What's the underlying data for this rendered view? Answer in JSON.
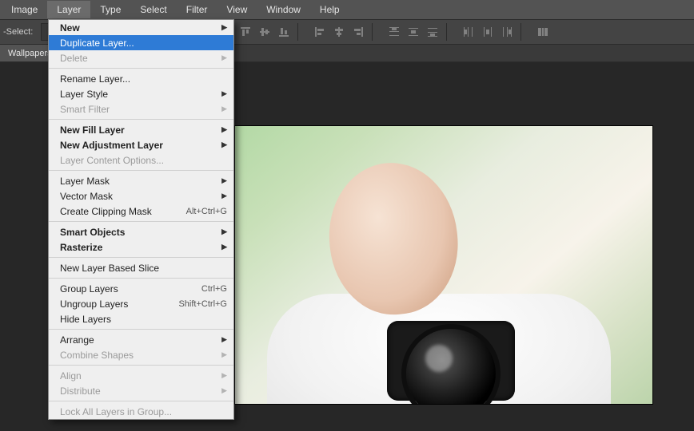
{
  "menubar": {
    "items": [
      "Image",
      "Layer",
      "Type",
      "Select",
      "Filter",
      "View",
      "Window",
      "Help"
    ],
    "active_index": 1
  },
  "toolbar": {
    "select_label": "-Select:"
  },
  "document": {
    "tab_label": "Wallpapers"
  },
  "dropdown": {
    "items": [
      {
        "label": "New",
        "arrow": true,
        "bold": true
      },
      {
        "label": "Duplicate Layer...",
        "highlighted": true
      },
      {
        "label": "Delete",
        "disabled": true,
        "arrow": true
      },
      {
        "sep": true
      },
      {
        "label": "Rename Layer..."
      },
      {
        "label": "Layer Style",
        "arrow": true
      },
      {
        "label": "Smart Filter",
        "disabled": true,
        "arrow": true
      },
      {
        "sep": true
      },
      {
        "label": "New Fill Layer",
        "arrow": true,
        "bold": true
      },
      {
        "label": "New Adjustment Layer",
        "arrow": true,
        "bold": true
      },
      {
        "label": "Layer Content Options...",
        "disabled": true
      },
      {
        "sep": true
      },
      {
        "label": "Layer Mask",
        "arrow": true
      },
      {
        "label": "Vector Mask",
        "arrow": true
      },
      {
        "label": "Create Clipping Mask",
        "shortcut": "Alt+Ctrl+G"
      },
      {
        "sep": true
      },
      {
        "label": "Smart Objects",
        "arrow": true,
        "bold": true
      },
      {
        "label": "Rasterize",
        "arrow": true,
        "bold": true
      },
      {
        "sep": true
      },
      {
        "label": "New Layer Based Slice"
      },
      {
        "sep": true
      },
      {
        "label": "Group Layers",
        "shortcut": "Ctrl+G"
      },
      {
        "label": "Ungroup Layers",
        "shortcut": "Shift+Ctrl+G"
      },
      {
        "label": "Hide Layers"
      },
      {
        "sep": true
      },
      {
        "label": "Arrange",
        "arrow": true
      },
      {
        "label": "Combine Shapes",
        "disabled": true,
        "arrow": true
      },
      {
        "sep": true
      },
      {
        "label": "Align",
        "disabled": true,
        "arrow": true
      },
      {
        "label": "Distribute",
        "disabled": true,
        "arrow": true
      },
      {
        "sep": true
      },
      {
        "label": "Lock All Layers in Group...",
        "disabled": true
      }
    ]
  }
}
